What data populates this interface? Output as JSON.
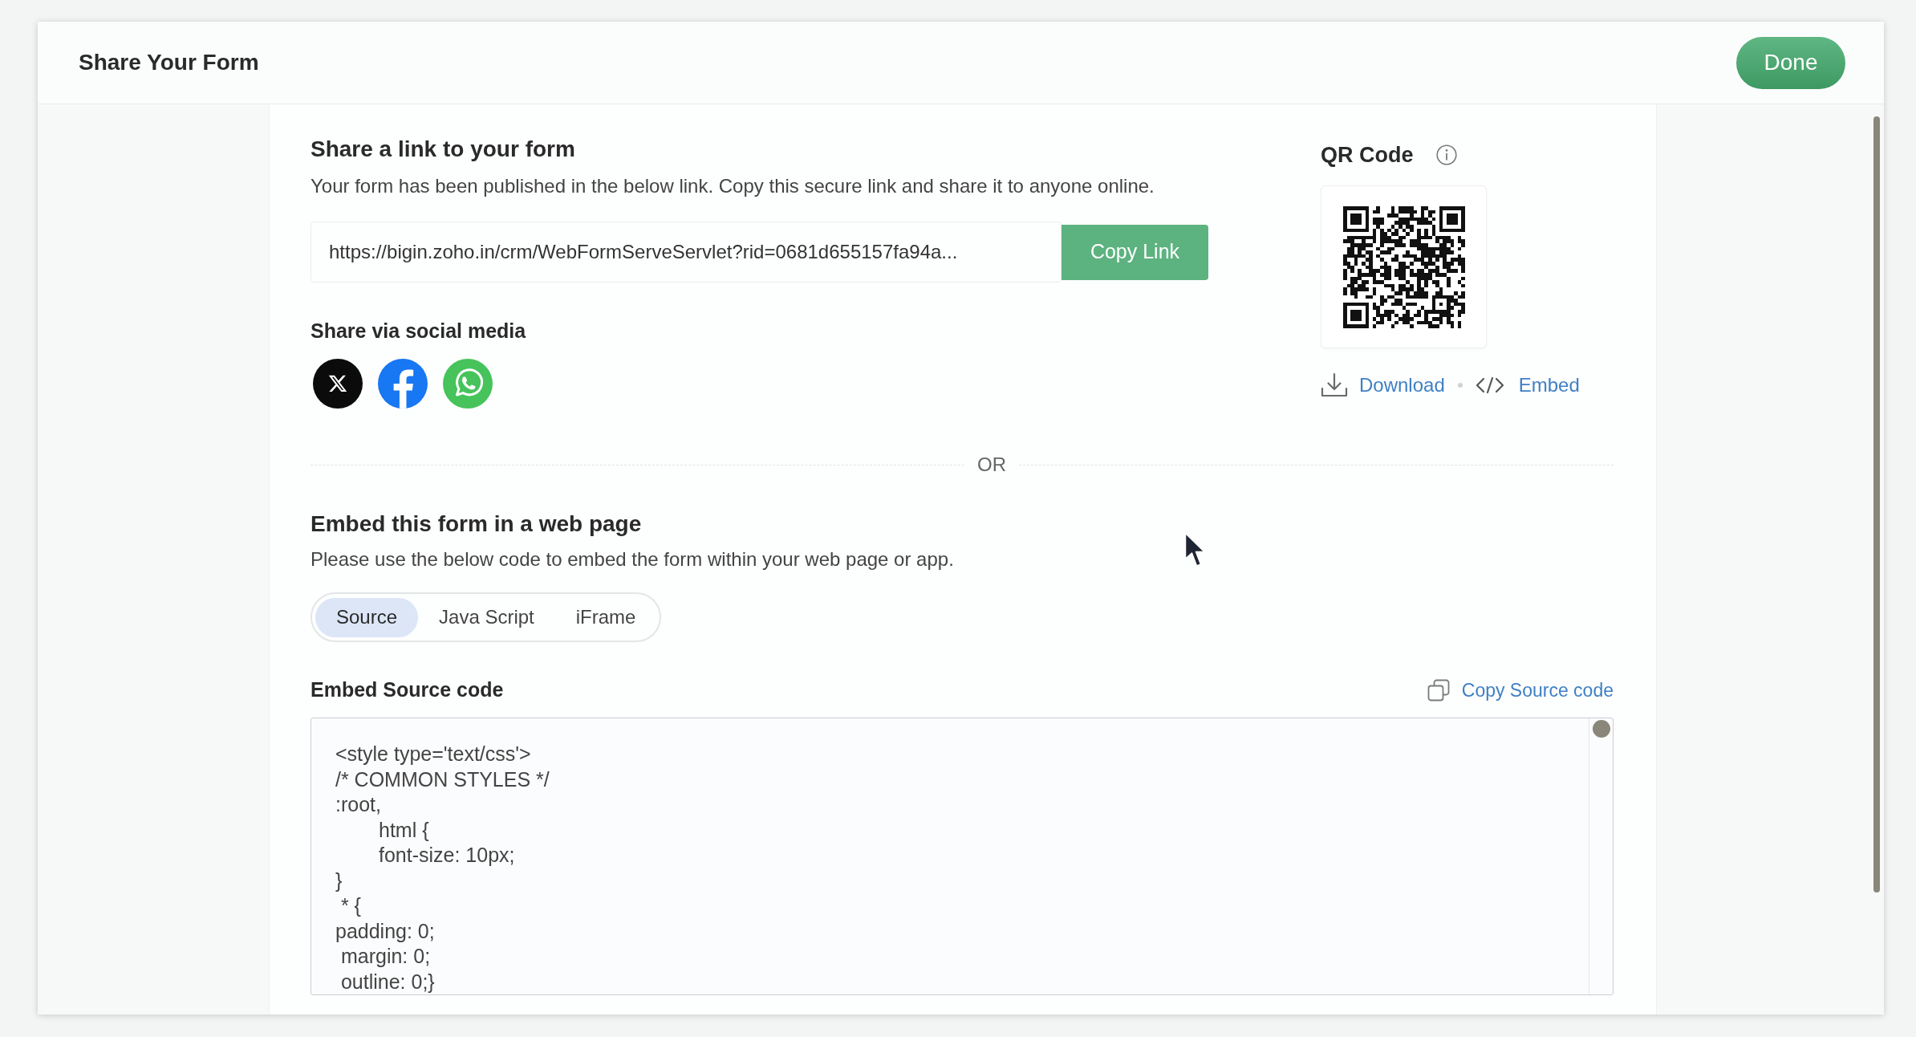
{
  "header": {
    "title": "Share Your Form",
    "done_button": "Done"
  },
  "share_link": {
    "title": "Share a link to your form",
    "description": "Your form has been published in the below link. Copy this secure link and share it to anyone online.",
    "link": "https://bigin.zoho.in/crm/WebFormServeServlet?rid=0681d655157fa94a...",
    "copy_button": "Copy Link"
  },
  "social": {
    "title": "Share via social media",
    "buttons": [
      {
        "kind": "x"
      },
      {
        "kind": "facebook"
      },
      {
        "kind": "whatsapp"
      }
    ]
  },
  "qr": {
    "title": "QR Code",
    "download": "Download",
    "embed": "Embed"
  },
  "divider": "OR",
  "embed": {
    "title": "Embed this form in a web page",
    "description": "Please use the below code to embed the form within your web page or app.",
    "tabs": [
      {
        "label": "Source",
        "selected": true
      },
      {
        "label": "Java Script",
        "selected": false
      },
      {
        "label": "iFrame",
        "selected": false
      }
    ],
    "code_title": "Embed Source code",
    "copy_code": "Copy Source code",
    "code_lines": [
      "<style type='text/css'>",
      "/* COMMON STYLES */",
      ":root,",
      "\thtml {",
      "\tfont-size: 10px;",
      "}",
      " * {",
      "padding: 0;",
      " margin: 0;",
      " outline: 0;}"
    ]
  }
}
